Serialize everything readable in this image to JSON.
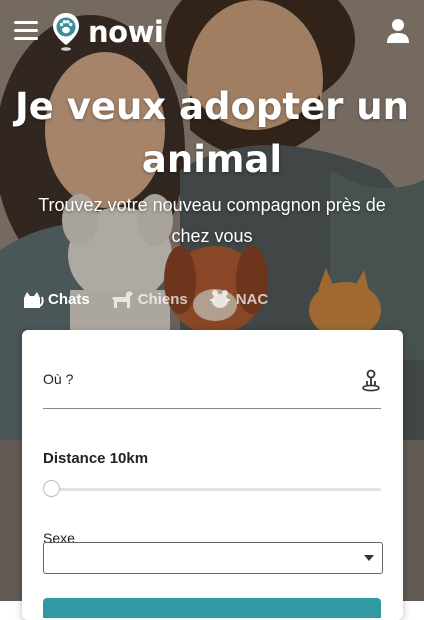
{
  "app": {
    "brand": "nowi",
    "accent": "#2f9aa0"
  },
  "header": {
    "menu_icon": "hamburger-menu-icon",
    "user_icon": "user-icon"
  },
  "hero": {
    "title": "Je veux adopter un animal",
    "subtitle": "Trouvez votre nouveau compagnon près de chez vous"
  },
  "tabs": [
    {
      "label": "Chats",
      "icon": "cat-icon",
      "active": true
    },
    {
      "label": "Chiens",
      "icon": "dog-icon",
      "active": false
    },
    {
      "label": "NAC",
      "icon": "small-pet-icon",
      "active": false
    }
  ],
  "form": {
    "where_label": "Où ?",
    "where_value": "",
    "geolocate_icon": "geolocate-icon",
    "distance_label": "Distance 10km",
    "distance_value_km": 10,
    "sex_label": "Sexe",
    "sex_value": ""
  }
}
